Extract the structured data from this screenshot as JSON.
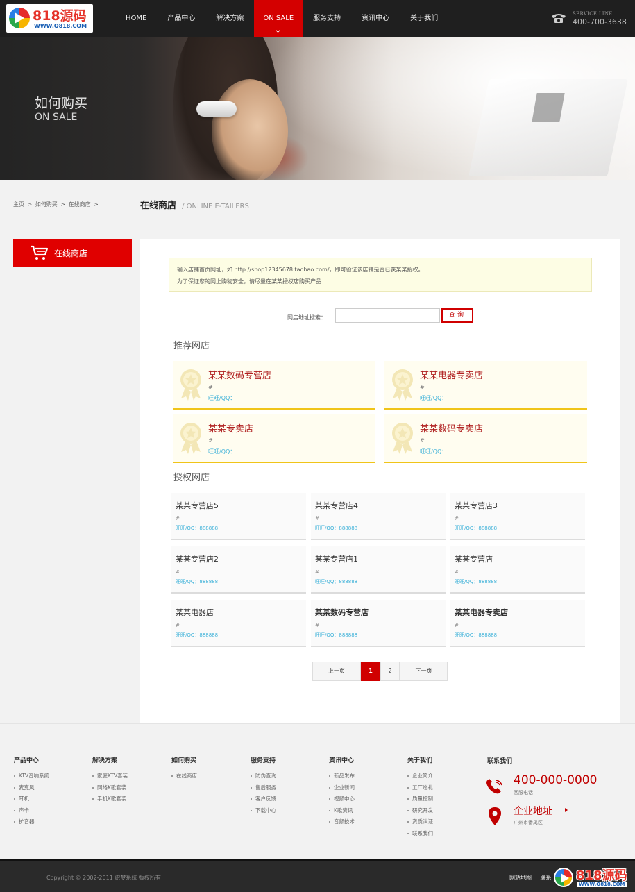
{
  "logo": {
    "main": "818源码",
    "sub": "WWW.Q818.COM"
  },
  "nav": [
    {
      "label": "HOME"
    },
    {
      "label": "产品中心"
    },
    {
      "label": "解决方案"
    },
    {
      "label": "ON SALE",
      "active": true
    },
    {
      "label": "服务支持"
    },
    {
      "label": "资讯中心"
    },
    {
      "label": "关于我们"
    }
  ],
  "service": {
    "label": "SERVICE LINE",
    "number": "400-700-3638"
  },
  "banner": {
    "title": "如何购买",
    "subtitle": "ON SALE"
  },
  "breadcrumb": [
    "主页",
    ">",
    "如何购买",
    ">",
    "在线商店",
    ">"
  ],
  "page": {
    "title": "在线商店",
    "title_en": "/ ONLINE E-TAILERS"
  },
  "sidebar": {
    "label": "在线商店"
  },
  "notice": {
    "line1": "输入店铺首页网址，如 http://shop12345678.taobao.com/，即可验证该店铺是否已获某某授权。",
    "line2": "为了保证您的网上购物安全，请尽量在某某授权店购买产品"
  },
  "search": {
    "label": "网店地址搜索：",
    "value": "",
    "placeholder": "",
    "button": "查询"
  },
  "recommended": {
    "title": "推荐网店",
    "stores": [
      {
        "name": "某某数码专营店",
        "url": "#",
        "qq": "旺旺/QQ："
      },
      {
        "name": "某某电器专卖店",
        "url": "#",
        "qq": "旺旺/QQ："
      },
      {
        "name": "某某专卖店",
        "url": "#",
        "qq": "旺旺/QQ："
      },
      {
        "name": "某某数码专卖店",
        "url": "#",
        "qq": "旺旺/QQ："
      }
    ]
  },
  "authorized": {
    "title": "授权网店",
    "stores": [
      {
        "name": "某某专营店5",
        "url": "#",
        "qq": "旺旺/QQ：888888"
      },
      {
        "name": "某某专营店4",
        "url": "#",
        "qq": "旺旺/QQ：888888"
      },
      {
        "name": "某某专营店3",
        "url": "#",
        "qq": "旺旺/QQ：888888"
      },
      {
        "name": "某某专营店2",
        "url": "#",
        "qq": "旺旺/QQ：888888"
      },
      {
        "name": "某某专营店1",
        "url": "#",
        "qq": "旺旺/QQ：888888"
      },
      {
        "name": "某某专营店",
        "url": "#",
        "qq": "旺旺/QQ：888888"
      },
      {
        "name": "某某电器店",
        "url": "#",
        "qq": "旺旺/QQ：888888"
      },
      {
        "name": "某某数码专营店",
        "url": "#",
        "qq": "旺旺/QQ：888888"
      },
      {
        "name": "某某电器专卖店",
        "url": "#",
        "qq": "旺旺/QQ：888888"
      }
    ]
  },
  "pagination": {
    "prev": "上一页",
    "pages": [
      "1",
      "2"
    ],
    "current": "1",
    "next": "下一页"
  },
  "footer": {
    "columns": [
      {
        "title": "产品中心",
        "items": [
          "KTV音响系统",
          "麦克风",
          "耳机",
          "声卡",
          "扩音器"
        ]
      },
      {
        "title": "解决方案",
        "items": [
          "家庭KTV套装",
          "网络K歌套装",
          "手机K歌套装"
        ]
      },
      {
        "title": "如何购买",
        "items": [
          "在线商店"
        ]
      },
      {
        "title": "服务支持",
        "items": [
          "防伪查询",
          "售后服务",
          "客户反馈",
          "下载中心"
        ]
      },
      {
        "title": "资讯中心",
        "items": [
          "新品发布",
          "企业新闻",
          "视频中心",
          "K歌资讯",
          "音频技术"
        ]
      },
      {
        "title": "关于我们",
        "items": [
          "企业简介",
          "工厂巡礼",
          "质量控制",
          "研究开发",
          "资质认证",
          "联系我们"
        ]
      }
    ],
    "contact": {
      "title": "联系我们",
      "phone": "400-000-0000",
      "phone_label": "客服电话",
      "address_title": "企业地址",
      "address": "广州市番禺区"
    },
    "copyright": "Copyright © 2002-2011 织梦系统 版权所有",
    "links": [
      "网站地图",
      "联系"
    ]
  },
  "colors": {
    "brand_red": "#d40000",
    "header_bg": "#1f1f1f",
    "qq_blue": "#3ab0d8",
    "medal_gold": "#f0c419"
  }
}
